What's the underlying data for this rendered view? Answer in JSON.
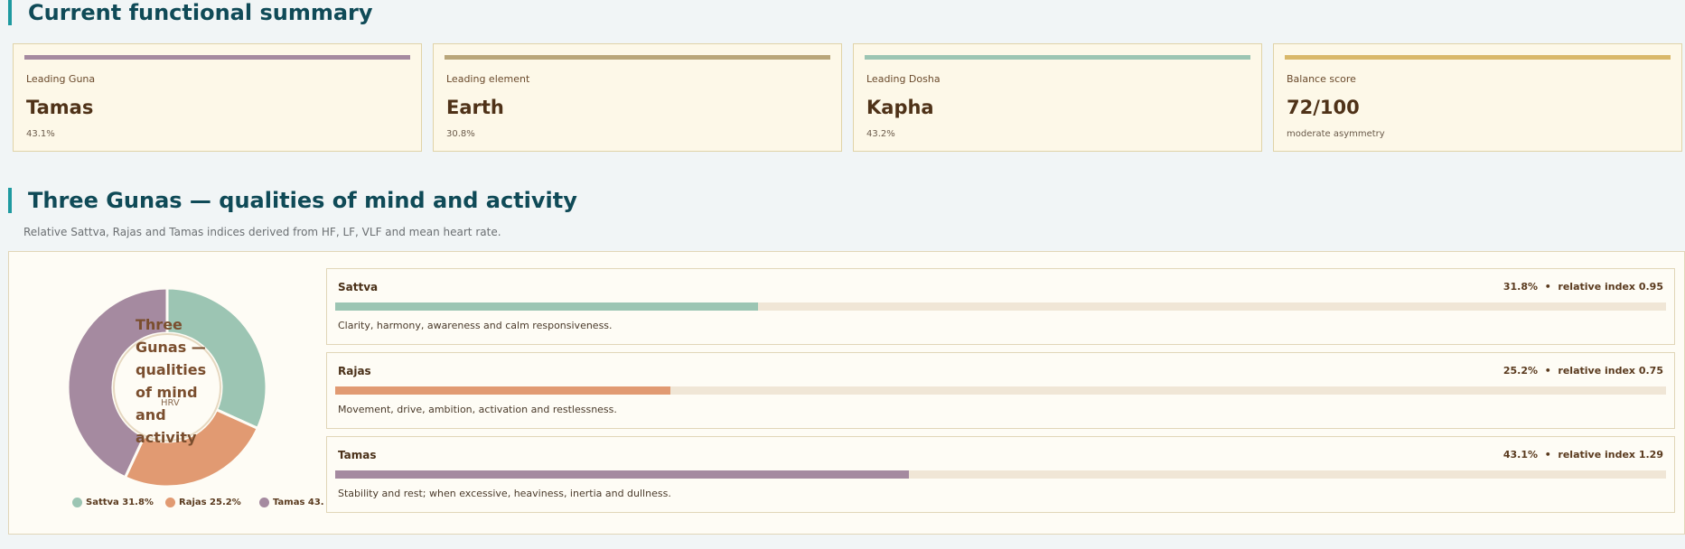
{
  "summary": {
    "title": "Current functional summary",
    "cards": [
      {
        "label": "Leading Guna",
        "value": "Tamas",
        "note": "43.1%",
        "color": "#a58aa0"
      },
      {
        "label": "Leading element",
        "value": "Earth",
        "note": "30.8%",
        "color": "#b9a67a"
      },
      {
        "label": "Leading Dosha",
        "value": "Kapha",
        "note": "43.2%",
        "color": "#9cc5b3"
      },
      {
        "label": "Balance score",
        "value": "72/100",
        "note": "moderate asymmetry",
        "color": "#d9b86a"
      }
    ]
  },
  "gunas": {
    "title": "Three Gunas — qualities of mind and activity",
    "subtitle": "Relative Sattva, Rajas and Tamas indices derived from HF, LF, VLF and mean heart rate.",
    "donut_center_title": "Three Gunas — qualities of mind and activity",
    "donut_center_sub": "HRV",
    "legend": [
      {
        "label": "Sattva 31.8%",
        "color": "#9cc5b3"
      },
      {
        "label": "Rajas 25.2%",
        "color": "#e19a72"
      },
      {
        "label": "Tamas 43.",
        "color": "#a58aa0"
      }
    ],
    "items": [
      {
        "name": "Sattva",
        "percent": "31.8%",
        "separator": "•",
        "index_text": "relative index 0.95",
        "fraction": 0.318,
        "color": "#9cc5b3",
        "description": "Clarity, harmony, awareness and calm responsiveness."
      },
      {
        "name": "Rajas",
        "percent": "25.2%",
        "separator": "•",
        "index_text": "relative index 0.75",
        "fraction": 0.252,
        "color": "#e19a72",
        "description": "Movement, drive, ambition, activation and restlessness."
      },
      {
        "name": "Tamas",
        "percent": "43.1%",
        "separator": "•",
        "index_text": "relative index 1.29",
        "fraction": 0.431,
        "color": "#a58aa0",
        "description": "Stability and rest; when excessive, heaviness, inertia and dullness."
      }
    ]
  },
  "chart_data": {
    "type": "pie",
    "categories": [
      "Sattva",
      "Rajas",
      "Tamas"
    ],
    "values": [
      31.8,
      25.2,
      43.1
    ],
    "title": "Three Gunas — qualities of mind and activity"
  }
}
